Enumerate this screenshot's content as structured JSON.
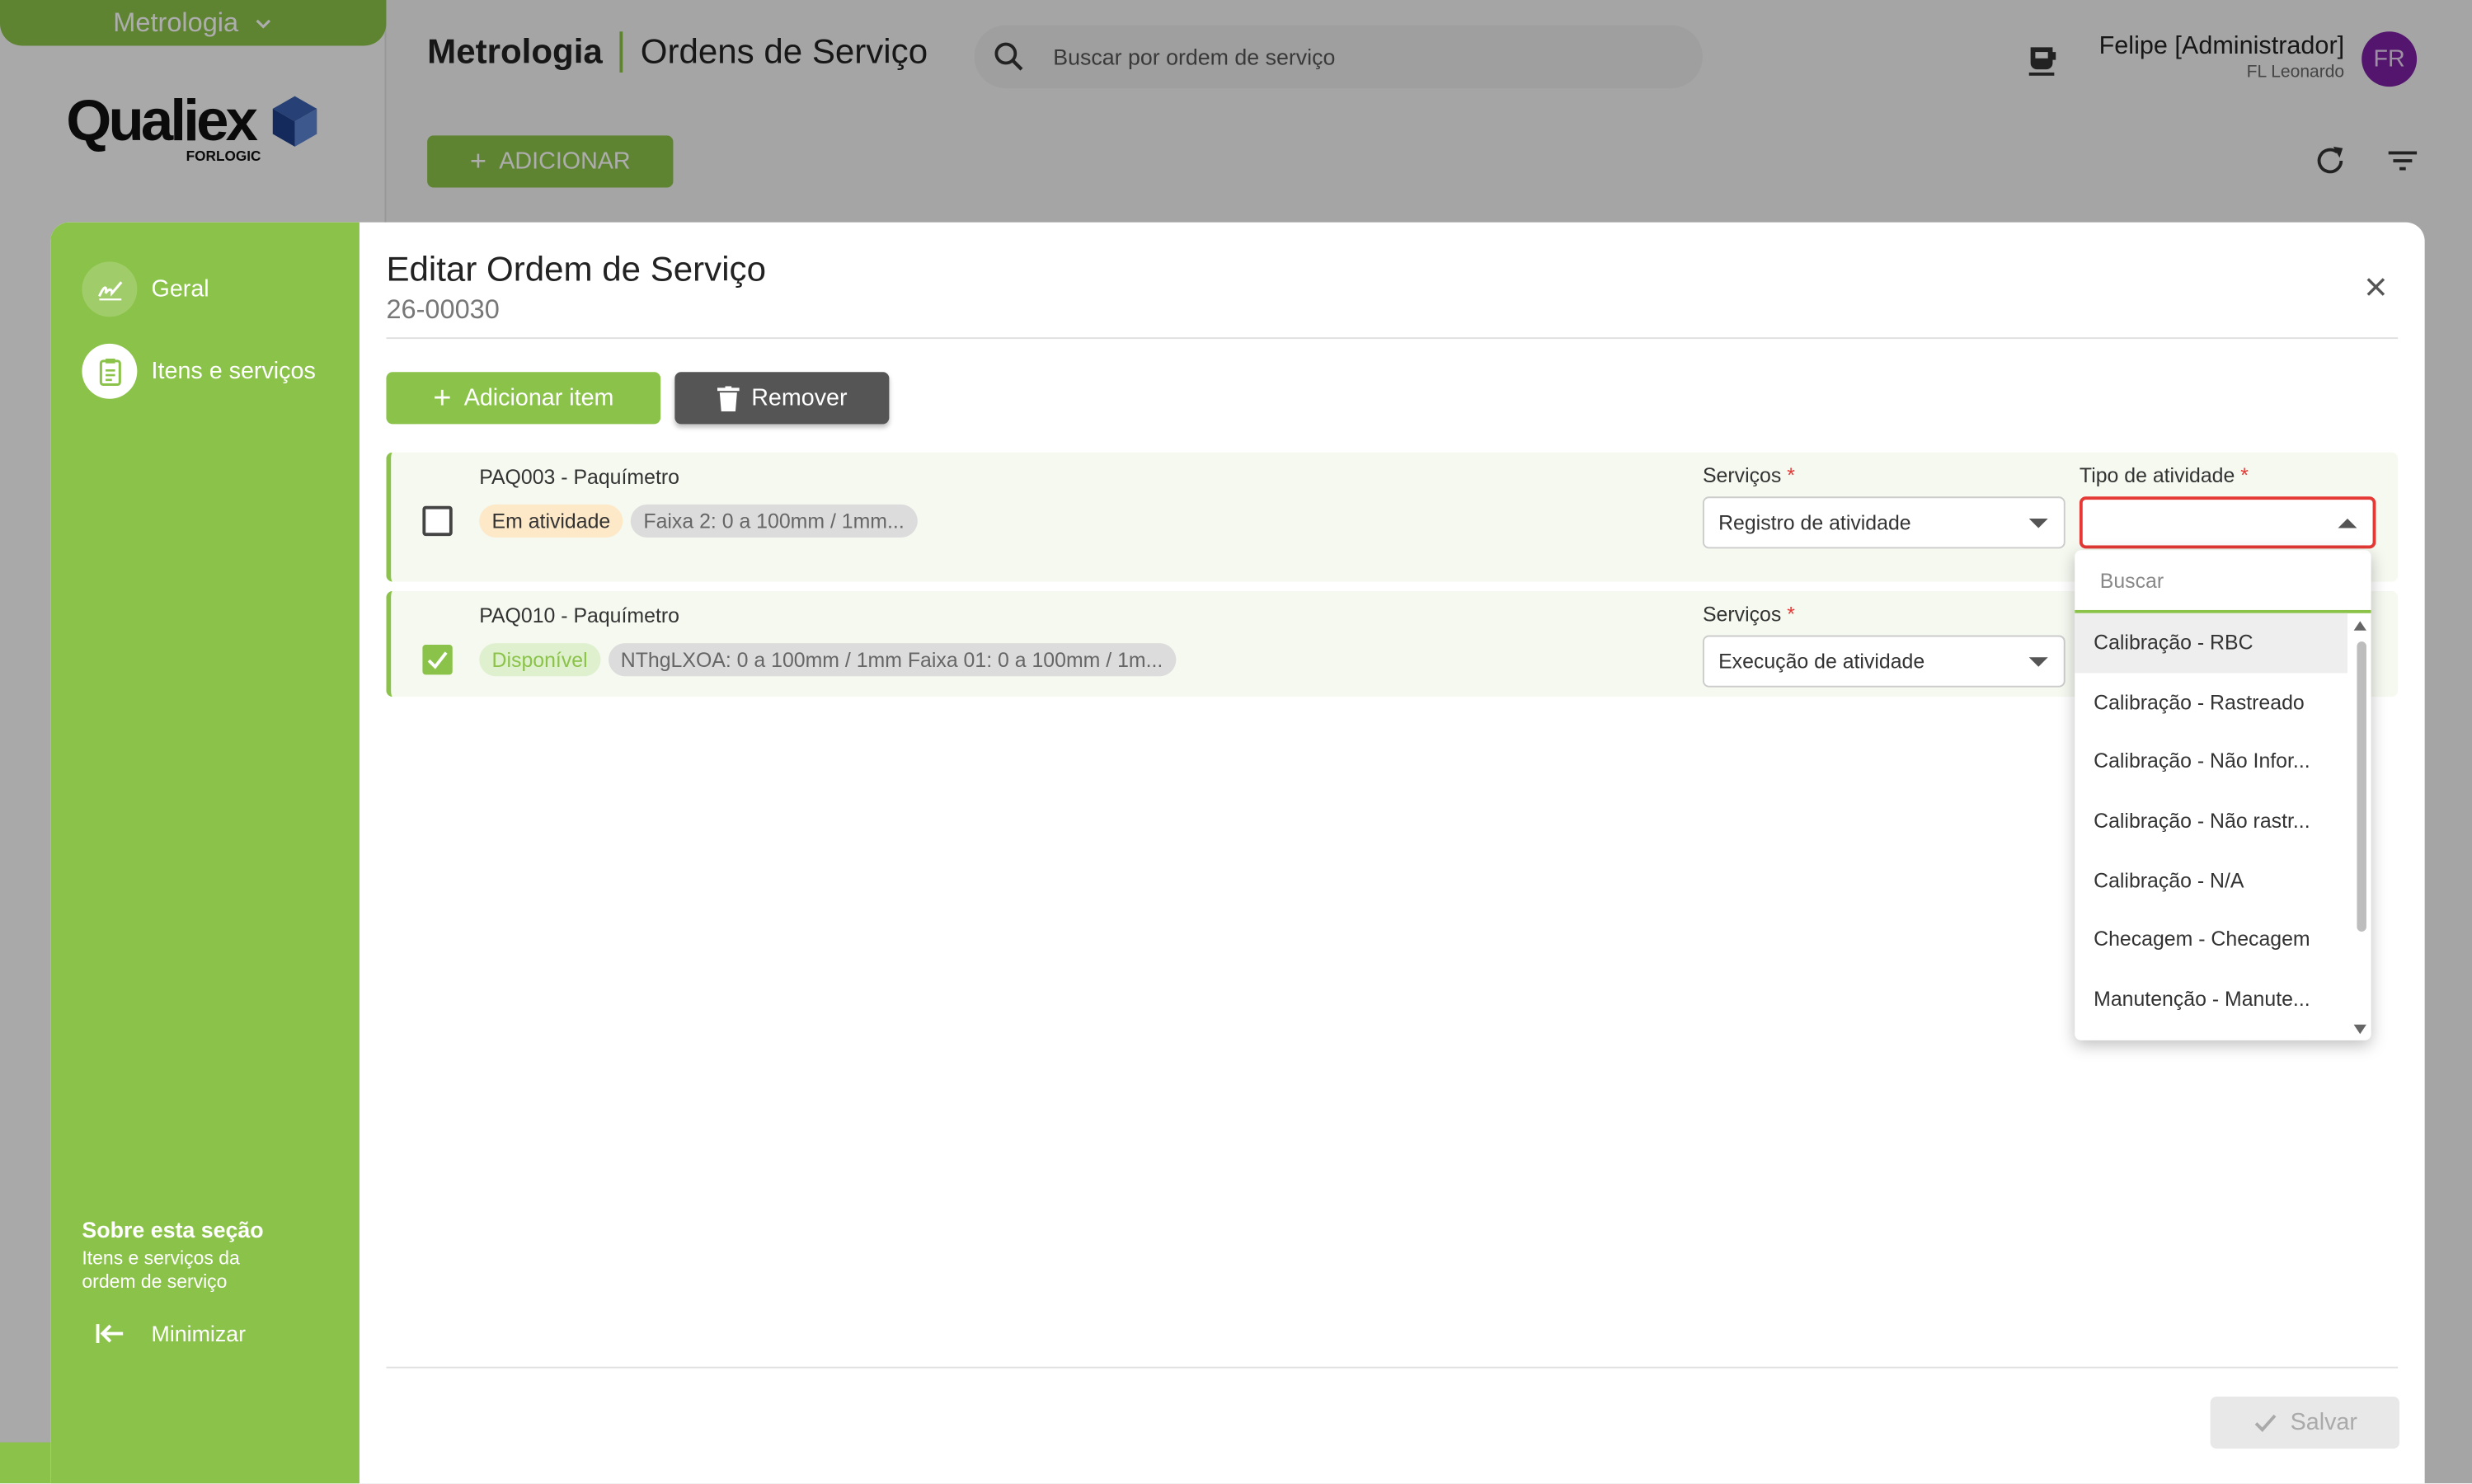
{
  "app": {
    "module": "Metrologia",
    "logo_text": "Qualiex",
    "logo_sub": "FORLOGIC",
    "title_bold": "Metrologia",
    "title_rest": "Ordens de Serviço",
    "search_placeholder": "Buscar por ordem de serviço",
    "user_name": "Felipe [Administrador]",
    "user_company": "FL Leonardo",
    "user_initials": "FR",
    "add_label": "ADICIONAR",
    "accent_color": "#8bc34a"
  },
  "modal": {
    "title": "Editar Ordem de Serviço",
    "code": "26-00030",
    "nav": [
      {
        "label": "Geral",
        "icon": "signature-icon"
      },
      {
        "label": "Itens e serviços",
        "icon": "clipboard-icon"
      }
    ],
    "about_title": "Sobre esta seção",
    "about_text": "Itens e serviços da ordem de serviço",
    "minimize_label": "Minimizar",
    "add_item_label": "Adicionar item",
    "remove_label": "Remover",
    "save_label": "Salvar",
    "services_label": "Serviços",
    "activity_type_label": "Tipo de atividade",
    "required_mark": "*",
    "items": [
      {
        "name": "PAQ003 - Paquímetro",
        "checked": false,
        "status": "Em atividade",
        "range": "Faixa 2: 0 a 100mm / 1mm...",
        "service": "Registro de atividade",
        "activity_type": ""
      },
      {
        "name": "PAQ010 - Paquímetro",
        "checked": true,
        "status": "Disponível",
        "range": "NThgLXOA: 0 a 100mm / 1mm Faixa 01: 0 a 100mm / 1m...",
        "service": "Execução de atividade"
      }
    ],
    "dropdown": {
      "search_placeholder": "Buscar",
      "options": [
        "Calibração - RBC",
        "Calibração - Rastreado",
        "Calibração - Não Infor...",
        "Calibração - Não rastr...",
        "Calibração - N/A",
        "Checagem - Checagem",
        "Manutenção - Manute..."
      ],
      "highlighted": "Calibração - RBC"
    }
  }
}
